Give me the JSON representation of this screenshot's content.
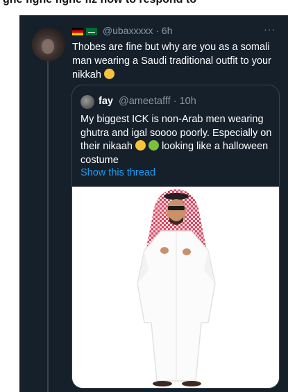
{
  "top_strip": {
    "text": "ghe fighe fighe fiz how to respond to"
  },
  "tweet": {
    "handle": "@ubaxxxxx",
    "separator": "·",
    "time": "6h",
    "more_label": "···",
    "text": "Thobes are fine but why are you as a somali man wearing a Saudi traditional outfit to your nikkah",
    "flags": [
      "germany-flag",
      "saudi-arabia-flag"
    ]
  },
  "quote": {
    "name": "fay",
    "handle": "@ameetafff",
    "separator": "·",
    "time": "10h",
    "text_part1": "My biggest ICK is non-Arab men wearing ghutra and igal soooo poorly. Especially on their nikaah",
    "text_part2": "looking like a halloween costume",
    "show_thread": "Show this thread"
  },
  "colors": {
    "panel_bg": "#15202b",
    "border": "#38444d",
    "muted_text": "#8899a6",
    "link": "#1d9bf0"
  }
}
